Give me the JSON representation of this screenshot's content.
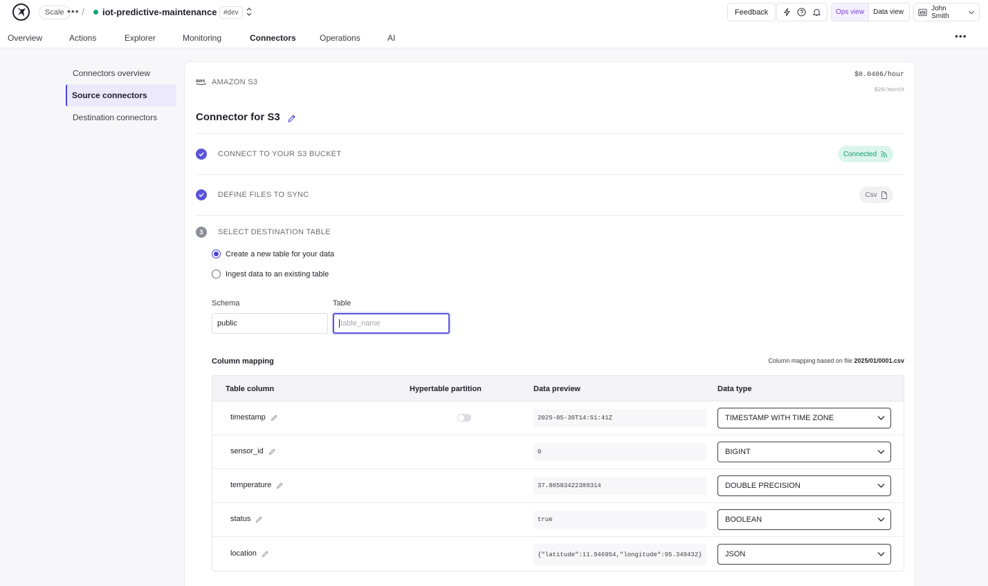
{
  "topbar": {
    "plan": "Scale",
    "project_name": "iot-predictive-maintenance",
    "env_tag": "#dev",
    "feedback_label": "Feedback",
    "ops_view_label": "Ops view",
    "data_view_label": "Data view",
    "user_name": "John Smith",
    "status_color": "#13a37a",
    "accent_color": "#7b3fd6"
  },
  "nav": {
    "tabs": [
      {
        "label": "Overview"
      },
      {
        "label": "Actions"
      },
      {
        "label": "Explorer"
      },
      {
        "label": "Monitoring"
      },
      {
        "label": "Connectors",
        "active": true
      },
      {
        "label": "Operations"
      },
      {
        "label": "AI"
      }
    ]
  },
  "sidebar": {
    "items": [
      {
        "label": "Connectors overview"
      },
      {
        "label": "Source connectors",
        "active": true
      },
      {
        "label": "Destination connectors"
      }
    ]
  },
  "connector": {
    "provider": "AMAZON S3",
    "provider_logo": "aws",
    "price_hour": "$0.0406/hour",
    "price_month": "$29/month",
    "title": "Connector for S3",
    "steps": [
      {
        "label": "CONNECT TO YOUR S3 BUCKET",
        "state": "done",
        "badge": "Connected"
      },
      {
        "label": "DEFINE FILES TO SYNC",
        "state": "done",
        "badge": "Csv"
      },
      {
        "label": "SELECT DESTINATION TABLE",
        "state": "active",
        "number": "3"
      }
    ],
    "options": [
      {
        "label": "Create a new table for your data",
        "checked": true
      },
      {
        "label": "Ingest data to an existing table",
        "checked": false
      }
    ],
    "schema_label": "Schema",
    "schema_value": "public",
    "table_label": "Table",
    "table_placeholder": "table_name",
    "mapping_title": "Column mapping",
    "mapping_note_prefix": "Column mapping based on file",
    "mapping_file": "2025/01/0001.csv",
    "columns_header": {
      "name": "Table column",
      "partition": "Hypertable partition",
      "preview": "Data preview",
      "type": "Data type"
    },
    "rows": [
      {
        "name": "timestamp",
        "preview": "2025-05-30T14:51:41Z",
        "type": "TIMESTAMP WITH TIME ZONE",
        "partition_toggle": true
      },
      {
        "name": "sensor_id",
        "preview": "0",
        "type": "BIGINT"
      },
      {
        "name": "temperature",
        "preview": "37.86583422389314",
        "type": "DOUBLE PRECISION"
      },
      {
        "name": "status",
        "preview": "true",
        "type": "BOOLEAN"
      },
      {
        "name": "location",
        "preview": "{\"latitude\":11.946954,\"longitude\":95.349432}",
        "type": "JSON"
      }
    ]
  }
}
